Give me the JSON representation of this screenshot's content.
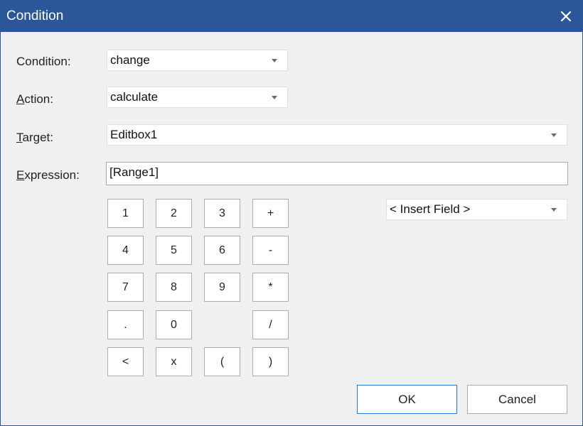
{
  "window": {
    "title": "Condition",
    "close_icon": "close-icon"
  },
  "form": {
    "condition": {
      "label_pre": "",
      "label_key": "",
      "label_post": "Condition:",
      "value": "change"
    },
    "action": {
      "label_pre": "",
      "label_key": "A",
      "label_post": "ction:",
      "value": "calculate"
    },
    "target": {
      "label_pre": "",
      "label_key": "T",
      "label_post": "arget:",
      "value": "Editbox1"
    },
    "expression": {
      "label_pre": "",
      "label_key": "E",
      "label_post": "xpression:",
      "value": "[Range1]"
    }
  },
  "keypad": {
    "row1": [
      "1",
      "2",
      "3",
      "+"
    ],
    "row2": [
      "4",
      "5",
      "6",
      "-"
    ],
    "row3": [
      "7",
      "8",
      "9",
      "*"
    ],
    "row4": [
      ".",
      "0",
      "/"
    ],
    "row5": [
      "<",
      "x",
      "(",
      ")"
    ]
  },
  "insert_field": {
    "value": "< Insert Field >"
  },
  "buttons": {
    "ok": "OK",
    "cancel": "Cancel"
  },
  "colors": {
    "titlebar": "#2b579a",
    "default_button_border": "#2b78d4"
  }
}
